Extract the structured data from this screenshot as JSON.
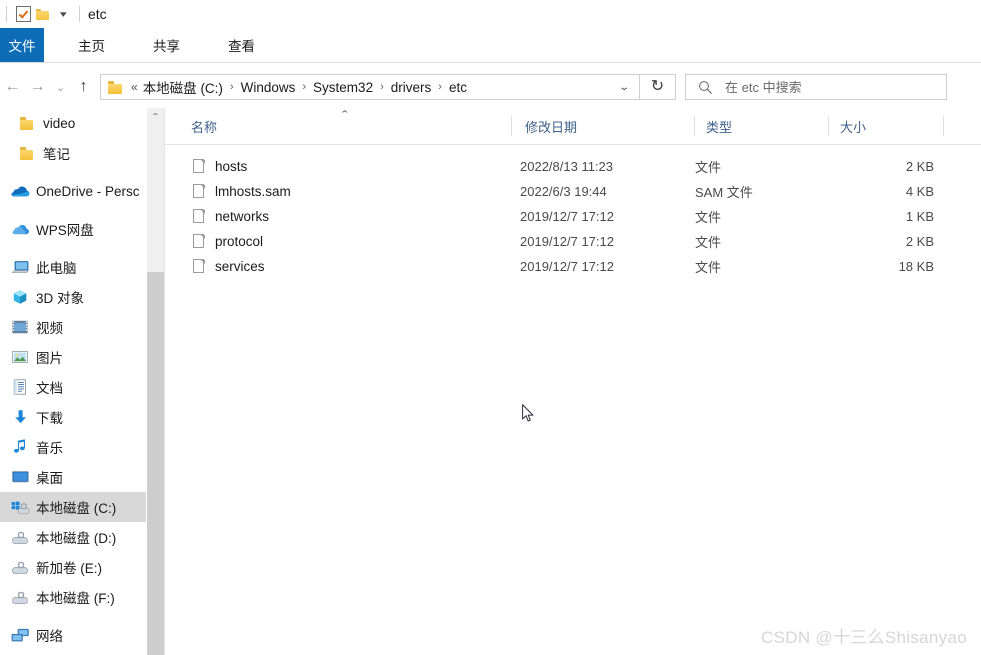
{
  "window": {
    "title": "etc",
    "quick_access": [
      {
        "name": "properties-icon",
        "label": "属性"
      },
      {
        "name": "new-folder-icon",
        "label": "新建文件夹"
      },
      {
        "name": "qat-chevron-down-icon",
        "label": "▾"
      }
    ]
  },
  "ribbon": {
    "tabs": [
      {
        "label": "文件",
        "active": true
      },
      {
        "label": "主页",
        "active": false
      },
      {
        "label": "共享",
        "active": false
      },
      {
        "label": "查看",
        "active": false
      }
    ],
    "accent": "#0d6cb6"
  },
  "addressbar": {
    "back_glyph": "←",
    "forward_glyph": "→",
    "recent_glyph": "⌄",
    "up_glyph": "↑",
    "overflow": "«",
    "breadcrumbs": [
      "本地磁盘 (C:)",
      "Windows",
      "System32",
      "drivers",
      "etc"
    ],
    "separator": "›",
    "dropdown_glyph": "⌄",
    "refresh_glyph": "↻",
    "refresh_label": "刷新"
  },
  "search": {
    "placeholder": "在 etc 中搜索",
    "value": ""
  },
  "sidebar": {
    "items": [
      {
        "label": "video",
        "icon": "folder-icon",
        "indent": 3,
        "selected": false
      },
      {
        "label": "笔记",
        "icon": "folder-icon",
        "indent": 3,
        "selected": false
      },
      {
        "label": "OneDrive - Persc",
        "icon": "onedrive-cloud-icon",
        "indent": 1,
        "selected": false
      },
      {
        "label": "WPS网盘",
        "icon": "wps-cloud-icon",
        "indent": 1,
        "selected": false
      },
      {
        "label": "此电脑",
        "icon": "this-pc-icon",
        "indent": 1,
        "selected": false
      },
      {
        "label": "3D 对象",
        "icon": "3d-objects-icon",
        "indent": 2,
        "selected": false
      },
      {
        "label": "视频",
        "icon": "videos-icon",
        "indent": 2,
        "selected": false
      },
      {
        "label": "图片",
        "icon": "pictures-icon",
        "indent": 2,
        "selected": false
      },
      {
        "label": "文档",
        "icon": "documents-icon",
        "indent": 2,
        "selected": false
      },
      {
        "label": "下载",
        "icon": "downloads-icon",
        "indent": 2,
        "selected": false
      },
      {
        "label": "音乐",
        "icon": "music-icon",
        "indent": 2,
        "selected": false
      },
      {
        "label": "桌面",
        "icon": "desktop-icon",
        "indent": 2,
        "selected": false
      },
      {
        "label": "本地磁盘 (C:)",
        "icon": "system-drive-icon",
        "indent": 2,
        "selected": true
      },
      {
        "label": "本地磁盘 (D:)",
        "icon": "drive-icon",
        "indent": 2,
        "selected": false
      },
      {
        "label": "新加卷 (E:)",
        "icon": "drive-icon",
        "indent": 2,
        "selected": false
      },
      {
        "label": "本地磁盘 (F:)",
        "icon": "drive-icon",
        "indent": 2,
        "selected": false
      },
      {
        "label": "网络",
        "icon": "network-icon",
        "indent": 1,
        "selected": false
      }
    ],
    "selected_bg": "#d8d8d8",
    "scroll_up_glyph": "⌃"
  },
  "filelist": {
    "columns": [
      {
        "key": "name",
        "label": "名称",
        "align": "left",
        "sorted": true,
        "sort_glyph": "⌃"
      },
      {
        "key": "modified",
        "label": "修改日期",
        "align": "left",
        "sorted": false
      },
      {
        "key": "type",
        "label": "类型",
        "align": "left",
        "sorted": false
      },
      {
        "key": "size",
        "label": "大小",
        "align": "right",
        "sorted": false
      }
    ],
    "rows": [
      {
        "name": "hosts",
        "modified": "2022/8/13 11:23",
        "type": "文件",
        "size": "2 KB",
        "icon": "file-icon"
      },
      {
        "name": "lmhosts.sam",
        "modified": "2022/6/3 19:44",
        "type": "SAM 文件",
        "size": "4 KB",
        "icon": "file-icon"
      },
      {
        "name": "networks",
        "modified": "2019/12/7 17:12",
        "type": "文件",
        "size": "1 KB",
        "icon": "file-icon"
      },
      {
        "name": "protocol",
        "modified": "2019/12/7 17:12",
        "type": "文件",
        "size": "2 KB",
        "icon": "file-icon"
      },
      {
        "name": "services",
        "modified": "2019/12/7 17:12",
        "type": "文件",
        "size": "18 KB",
        "icon": "file-icon"
      }
    ],
    "header_color": "#41618d"
  },
  "watermark": {
    "text": "CSDN @十三么Shisanyao"
  }
}
